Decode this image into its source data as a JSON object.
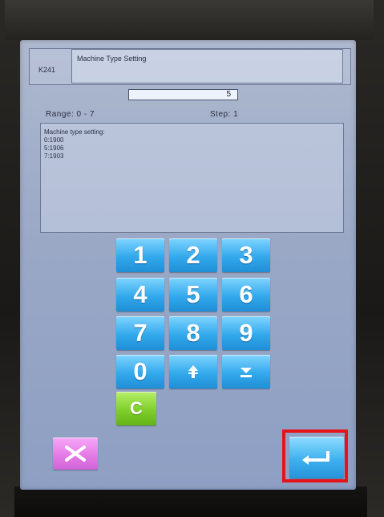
{
  "header": {
    "code": "K241",
    "title": "Machine Type Setting"
  },
  "value": {
    "current": "5",
    "range_label": "Range:  0  -  7",
    "step_label": "Step:  1"
  },
  "info": {
    "lines": [
      "Machine type setting:",
      "0:1900",
      "5:1906",
      "7:1903"
    ]
  },
  "keypad": {
    "keys": [
      "1",
      "2",
      "3",
      "4",
      "5",
      "6",
      "7",
      "8",
      "9",
      "0"
    ],
    "clear_label": "C"
  },
  "icons": {
    "up": "up-arrow-icon",
    "down": "down-arrow-icon",
    "cancel": "close-x-icon",
    "enter": "enter-return-icon"
  },
  "colors": {
    "key_blue": "#33a9ec",
    "clear_green": "#7fcf2b",
    "cancel_magenta": "#e57be6",
    "highlight_red": "#e5141a"
  }
}
